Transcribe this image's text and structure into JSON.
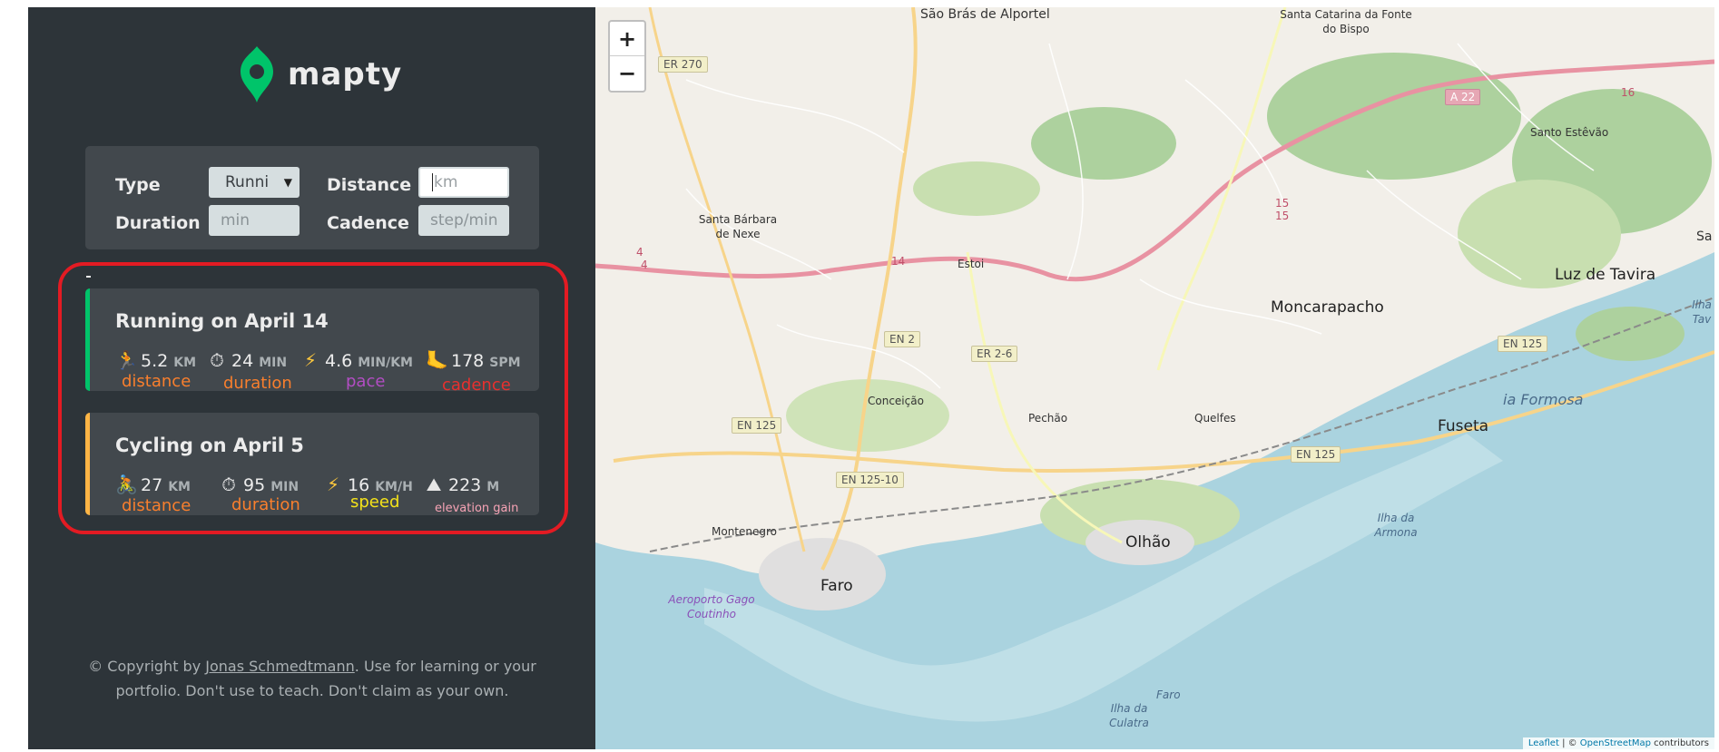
{
  "app": {
    "name": "mapty"
  },
  "form": {
    "type_label": "Type",
    "type_value": "Runni",
    "distance_label": "Distance",
    "distance_placeholder": "km",
    "duration_label": "Duration",
    "duration_placeholder": "min",
    "cadence_label": "Cadence",
    "cadence_placeholder": "step/min"
  },
  "workouts": [
    {
      "title": "Running on April 14",
      "color": "#00c46a",
      "details": [
        {
          "icon": "🏃",
          "value": "5.2",
          "unit": "KM",
          "caption": "distance",
          "caption_color": "#f97f2d"
        },
        {
          "icon": "⏱",
          "value": "24",
          "unit": "MIN",
          "caption": "duration",
          "caption_color": "#f97f2d"
        },
        {
          "icon": "⚡",
          "value": "4.6",
          "unit": "MIN/KM",
          "caption": "pace",
          "caption_color": "#b24dc3"
        },
        {
          "icon": "🦶",
          "value": "178",
          "unit": "SPM",
          "caption": "cadence",
          "caption_color": "#e8302e"
        }
      ]
    },
    {
      "title": "Cycling on April 5",
      "color": "#ffb545",
      "details": [
        {
          "icon": "🚴",
          "value": "27",
          "unit": "KM",
          "caption": "distance",
          "caption_color": "#f97f2d"
        },
        {
          "icon": "⏱",
          "value": "95",
          "unit": "MIN",
          "caption": "duration",
          "caption_color": "#f97f2d"
        },
        {
          "icon": "⚡",
          "value": "16",
          "unit": "KM/H",
          "caption": "speed",
          "caption_color": "#f4e21a"
        },
        {
          "icon": "⛰",
          "value": "223",
          "unit": "M",
          "caption": "elevation gain",
          "caption_color": "#f7a3b5"
        }
      ]
    }
  ],
  "copyright": {
    "prefix": "© Copyright by ",
    "author": "Jonas Schmedtmann",
    "suffix": ". Use for learning or your portfolio. Don't use to teach. Don't claim as your own."
  },
  "map": {
    "zoom_in": "+",
    "zoom_out": "−",
    "places": [
      "São Brás de Alportel",
      "Santa Catarina da Fonte do Bispo",
      "Santo Estêvão",
      "Santa Bárbara de Nexe",
      "Estoi",
      "Moncarapacho",
      "Luz de Tavira",
      "Conceição",
      "Pechão",
      "Quelfes",
      "Fuseta",
      "Montenegro",
      "Faro",
      "Olhão",
      "Aeroporto Gago Coutinho",
      "Ilha da Armona",
      "Ilha da Culatra",
      "ia Formosa",
      "Faro",
      "Sa",
      "Ilha Tav"
    ],
    "roads": [
      "ER 270",
      "A 22",
      "EN 2",
      "ER 2-6",
      "EN 125",
      "EN 125-10",
      "EN 125",
      "EN 125",
      "15",
      "15",
      "14",
      "4",
      "4",
      "16"
    ],
    "attribution_leaflet": "Leaflet",
    "attribution_sep": " | © ",
    "attribution_osm": "OpenStreetMap",
    "attribution_suffix": " contributors"
  }
}
